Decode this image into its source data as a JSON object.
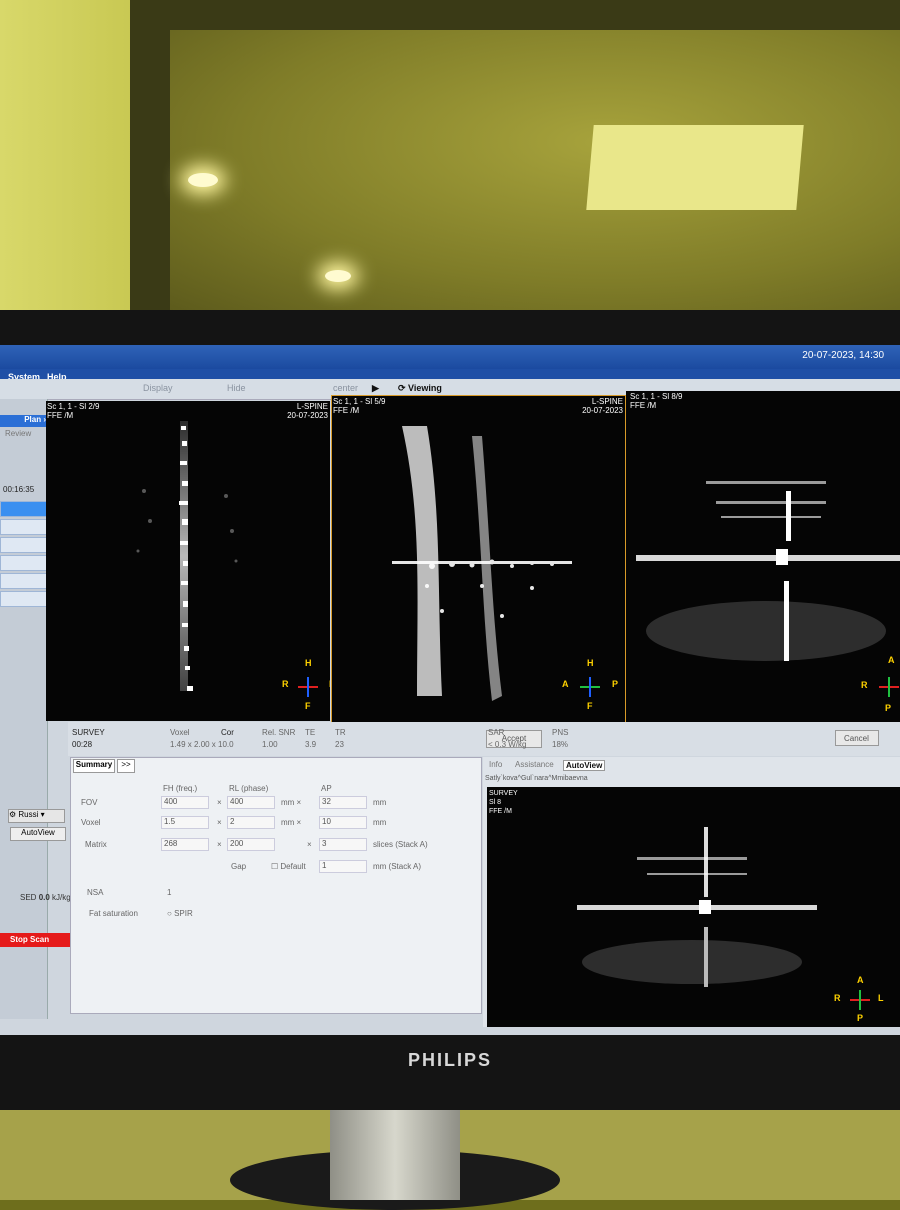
{
  "screen": {
    "datetime": "20-07-2023, 14:30",
    "menu": [
      "System",
      "Help"
    ],
    "toolbar": {
      "display": "Display",
      "hide": "Hide",
      "center": "center",
      "viewing": "Viewing"
    }
  },
  "left_panel": {
    "plan_label": "Plan",
    "review_label": "Review",
    "timer": "00:16:35",
    "language": "Russi",
    "autoview_label": "AutoView",
    "sed_label": "SED",
    "sed_value": "0.0",
    "sed_unit": "kJ/kg",
    "stop_label": "Stop Scan"
  },
  "viewports": [
    {
      "scan": "Sc 1, 1 - Sl 2/9",
      "seq": "FFE  /M",
      "exam": "L-SPINE",
      "date": "20-07-2023",
      "orient": {
        "top": "H",
        "bottom": "F",
        "left": "R",
        "right": "L"
      }
    },
    {
      "scan": "Sc 1, 1 - Sl 5/9",
      "seq": "FFE  /M",
      "exam": "L-SPINE",
      "date": "20-07-2023",
      "orient": {
        "top": "H",
        "bottom": "F",
        "left": "A",
        "right": "P"
      }
    },
    {
      "scan": "Sc 1, 1 - Sl 8/9",
      "seq": "FFE  /M",
      "exam": "",
      "date": "",
      "orient": {
        "top": "A",
        "bottom": "P",
        "left": "R",
        "right": ""
      }
    }
  ],
  "scan_info": {
    "name": "SURVEY",
    "time": "00:28",
    "voxel_label": "Voxel",
    "voxel_value": "1.49 x 2.00 x 10.0",
    "cor_label": "Cor",
    "rel_snr_label": "Rel. SNR",
    "rel_snr_value": "1.00",
    "te_label": "TE",
    "te_value": "3.9",
    "tr_label": "TR",
    "tr_value": "23",
    "accept_label": "Accept",
    "sar_label": "SAR",
    "sar_value": "< 0.3  W/kg",
    "pns_label": "PNS",
    "pns_value": "18%",
    "cancel_label": "Cancel"
  },
  "summary": {
    "tab_label": "Summary",
    "next_label": ">>",
    "fh_label": "FH (freq.)",
    "rl_label": "RL (phase)",
    "ap_label": "AP",
    "fov_label": "FOV",
    "fov": [
      "400",
      "400",
      "32"
    ],
    "fov_unit": "mm",
    "voxel_label": "Voxel",
    "voxel": [
      "1.5",
      "2",
      "10"
    ],
    "voxel_unit": "mm",
    "matrix_label": "Matrix",
    "matrix": [
      "268",
      "200",
      "3"
    ],
    "matrix_unit": "slices (Stack A)",
    "gap_label": "Gap",
    "gap_default": "Default",
    "gap_value": "1",
    "gap_unit": "mm (Stack A)",
    "nsa_label": "NSA",
    "nsa_value": "1",
    "fat_label": "Fat saturation",
    "fat_value": "SPIR",
    "times": "×",
    "mm_x": "mm ×"
  },
  "autoview": {
    "tabs": [
      "Info",
      "Assistance",
      "AutoView"
    ],
    "patient": "Satly`kova^Gul`nara^Mmibaevna",
    "scan": "SURVEY",
    "slice": "Sl 8",
    "seq": "FFE  /M",
    "orient": {
      "top": "A",
      "bottom": "P",
      "left": "R",
      "right": "L"
    }
  },
  "brand": "PHILIPS"
}
